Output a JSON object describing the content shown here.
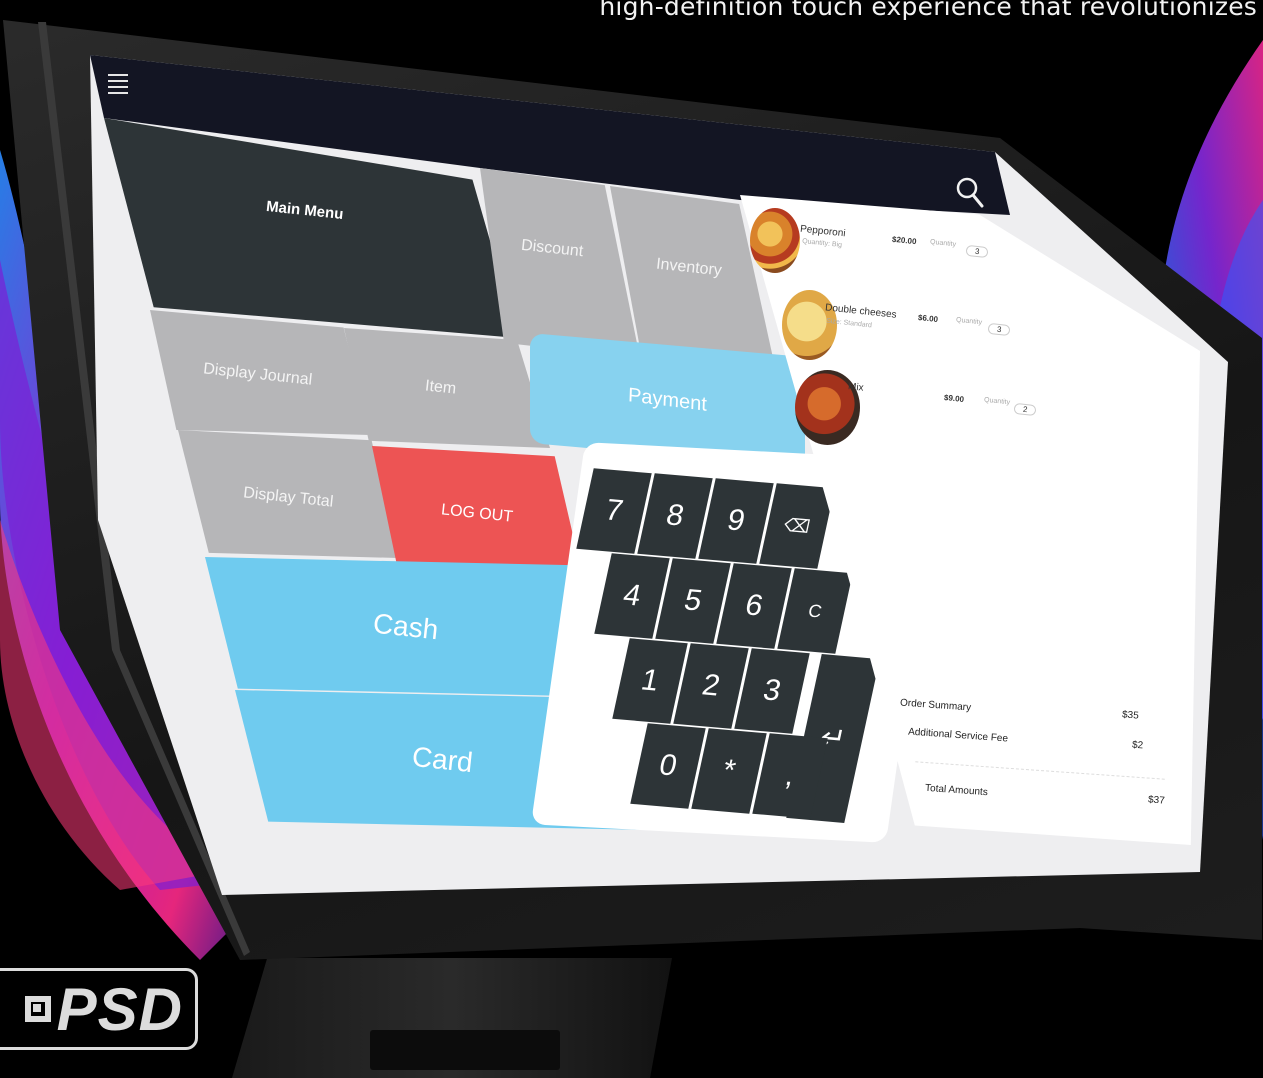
{
  "tagline": "high-definition touch experience that revolutionizes",
  "logo": {
    "text": "PSD"
  },
  "topbar": {
    "menu_icon": "hamburger-icon",
    "search_icon": "search-icon"
  },
  "tiles": {
    "main_menu": "Main Menu",
    "discount": "Discount",
    "inventory": "Inventory",
    "display_journal": "Display Journal",
    "item": "Item",
    "payment": "Payment",
    "display_total": "Display Total",
    "log_out": "LOG OUT",
    "cash": "Cash",
    "card": "Card"
  },
  "keypad": {
    "k7": "7",
    "k8": "8",
    "k9": "9",
    "kback": "⌫",
    "k4": "4",
    "k5": "5",
    "k6": "6",
    "kc": "C",
    "k1": "1",
    "k2": "2",
    "k3": "3",
    "kenter": "↵",
    "k0": "0",
    "kstar": "*",
    "kcomma": ","
  },
  "order": {
    "items": [
      {
        "name": "Pepporoni",
        "sub": "Quantity: Big",
        "price": "$20.00",
        "qty_label": "Quantity",
        "qty": "3"
      },
      {
        "name": "Double cheeses",
        "sub": "Size: Standard",
        "price": "$6.00",
        "qty_label": "Quantity",
        "qty": "3"
      },
      {
        "name": "Mix",
        "sub": "",
        "price": "$9.00",
        "qty_label": "Quantity",
        "qty": "2"
      }
    ],
    "summary": {
      "order_summary_label": "Order Summary",
      "order_summary_value": "$35",
      "service_fee_label": "Additional Service Fee",
      "service_fee_value": "$2",
      "total_label": "Total Amounts",
      "total_value": "$37"
    }
  },
  "colors": {
    "dark_tile": "#2d3437",
    "gray_tile": "#b6b6b8",
    "logout_red": "#ed5454",
    "blue_tile": "#6fcbef",
    "topbar": "#131523"
  }
}
